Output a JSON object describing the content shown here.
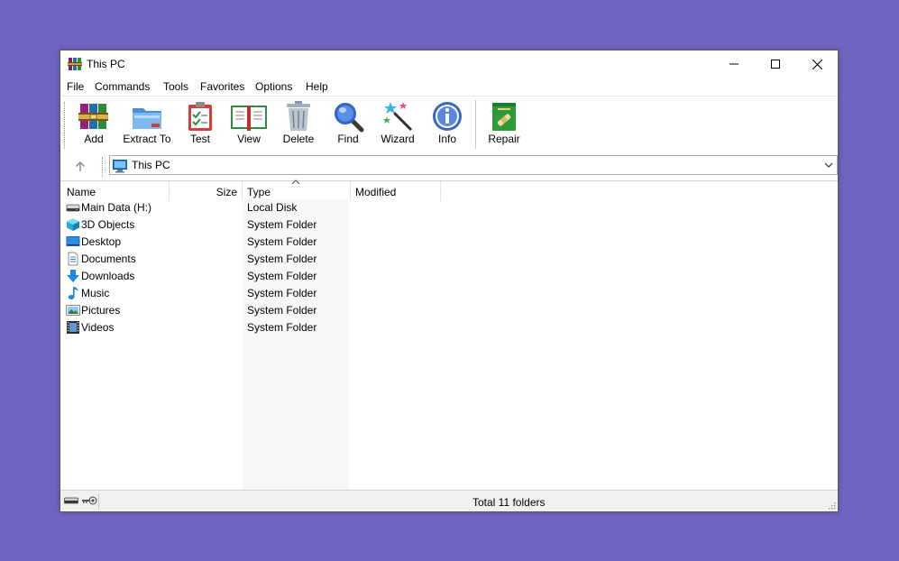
{
  "window": {
    "title": "This PC"
  },
  "menu": [
    "File",
    "Commands",
    "Tools",
    "Favorites",
    "Options",
    "Help"
  ],
  "toolbar": {
    "add": "Add",
    "extract": "Extract To",
    "test": "Test",
    "view": "View",
    "delete": "Delete",
    "find": "Find",
    "wizard": "Wizard",
    "info": "Info",
    "repair": "Repair"
  },
  "address": {
    "path": "This PC"
  },
  "columns": {
    "name": "Name",
    "size": "Size",
    "type": "Type",
    "modified": "Modified"
  },
  "rows": [
    {
      "name": "Main Data (H:)",
      "type": "Local Disk",
      "icon": "drive-icon"
    },
    {
      "name": "3D Objects",
      "type": "System Folder",
      "icon": "3d-objects-icon"
    },
    {
      "name": "Desktop",
      "type": "System Folder",
      "icon": "desktop-icon"
    },
    {
      "name": "Documents",
      "type": "System Folder",
      "icon": "documents-icon"
    },
    {
      "name": "Downloads",
      "type": "System Folder",
      "icon": "downloads-icon"
    },
    {
      "name": "Music",
      "type": "System Folder",
      "icon": "music-icon"
    },
    {
      "name": "Pictures",
      "type": "System Folder",
      "icon": "pictures-icon"
    },
    {
      "name": "Videos",
      "type": "System Folder",
      "icon": "videos-icon"
    }
  ],
  "status": {
    "text": "Total 11 folders"
  },
  "colors": {
    "background": "#6f65c2",
    "accent": "#0078d7"
  }
}
